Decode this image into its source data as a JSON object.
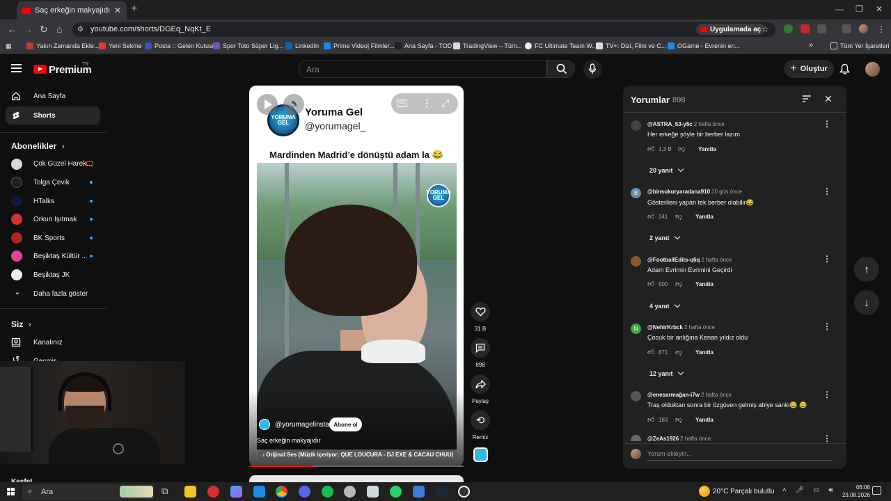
{
  "browser": {
    "tab_title": "Saç erkeğin makyajıdır - YouTube",
    "url": "youtube.com/shorts/DGEq_NqKt_E",
    "open_in_app": "Uygulamada aç",
    "bookmarks": [
      {
        "label": "Yakın Zamanda Ekle...",
        "color": "#c0392b"
      },
      {
        "label": "Yeni Sekme",
        "color": "#e53935"
      },
      {
        "label": "Posta :: Gelen Kutusu",
        "color": "#3f51b5"
      },
      {
        "label": "Spor Toto Süper Lig...",
        "color": "#7b4fc9"
      },
      {
        "label": "LinkedIn",
        "color": "#0a66c2"
      },
      {
        "label": "Prime Video| Filmler...",
        "color": "#1e88e5"
      },
      {
        "label": "Ana Sayfa - TOD",
        "color": "#222222"
      },
      {
        "label": "TradingView – Tüm...",
        "color": "#dddddd"
      },
      {
        "label": "FC Ultimate Team W...",
        "color": "#eeeeee"
      },
      {
        "label": "TV+: Dizi, Film ve C...",
        "color": "#dddddd"
      },
      {
        "label": "OGame - Evrenin en...",
        "color": "#1e88e5"
      }
    ],
    "all_bookmarks": "Tüm Yer İşaretleri"
  },
  "header": {
    "brand": "Premium",
    "region": "TR",
    "search_placeholder": "Ara",
    "create_label": "Oluştur"
  },
  "sidebar": {
    "main": [
      {
        "label": "Ana Sayfa",
        "icon": "home-icon"
      },
      {
        "label": "Shorts",
        "icon": "shorts-icon"
      }
    ],
    "subscriptions_title": "Abonelikler",
    "subscriptions": [
      {
        "label": "Çok Güzel Harek...",
        "color": "#d9d9d9",
        "badge": "live"
      },
      {
        "label": "Tolga Çevik",
        "color": "#1f1f1f",
        "badge": "dot"
      },
      {
        "label": "HTalks",
        "color": "#111a3a",
        "badge": "dot"
      },
      {
        "label": "Orkun Işıtmak",
        "color": "#d63031",
        "badge": "dot"
      },
      {
        "label": "BK Sports",
        "color": "#b3261e",
        "badge": "dot"
      },
      {
        "label": "Beşiktaş Kültür ...",
        "color": "#e84393",
        "badge": "dot"
      },
      {
        "label": "Beşiktaş JK",
        "color": "#eeeeee",
        "badge": "none"
      }
    ],
    "show_more": "Daha fazla göster",
    "you_title": "Siz",
    "you_items": [
      {
        "label": "Kanalınız",
        "icon": "channel-icon"
      },
      {
        "label": "Geçmiş",
        "icon": "history-icon"
      }
    ],
    "explore_title": "Keşfet"
  },
  "short": {
    "brand_name": "Yoruma Gel",
    "brand_handle": "@yorumagel_",
    "logo_text": "YORUMA GEL",
    "caption": "Mardinden Madrid’e dönüştü adam la 😂",
    "channel": "@yorumagelinsta",
    "subscribe": "Abone ol",
    "title": "Saç erkeğin makyajıdır",
    "audio": "♪ Orijinal Ses (Müzik içeriyor: QUE LOUCURA - DJ EXE & CACAU CHUU)",
    "progress": 0.3
  },
  "actions": {
    "likes": "31 B",
    "comments": "898",
    "share": "Paylaş",
    "remix": "Remix"
  },
  "comments": {
    "title": "Yorumlar",
    "count": "898",
    "items": [
      {
        "user": "@ASTRA_53-y5c",
        "time": "2 hafta önce",
        "text": "Her erkeğe şöyle bir berber lazım",
        "likes": "1,3 B",
        "replies": "20 yanıt",
        "avatar_color": "#444444",
        "avatar_letter": ""
      },
      {
        "user": "@binsukuryaradana910",
        "time": "10 gün önce",
        "text": "Gösterileni yapan tek berber olabilir😂",
        "likes": "241",
        "replies": "2 yanıt",
        "avatar_color": "#6a8caf",
        "avatar_letter": "B"
      },
      {
        "user": "@FootballEdits-q6q",
        "time": "2 hafta önce",
        "text": "Adam Evrimin Evrimini Geçirdi",
        "likes": "500",
        "replies": "4 yanıt",
        "avatar_color": "#8b5a2b",
        "avatar_letter": ""
      },
      {
        "user": "@NehirKrbck",
        "time": "2 hafta önce",
        "text": "Çocuk bir anlığına Kenan yıldız oldu",
        "likes": "871",
        "replies": "12 yanıt",
        "avatar_color": "#3ea63e",
        "avatar_letter": "N"
      },
      {
        "user": "@enesarmağan-i7w",
        "time": "2 hafta önce",
        "text": "Traş olduktan sonra bir özgüven gelmiş abiye sanki😂 😂",
        "likes": "183",
        "replies": "",
        "avatar_color": "#555555",
        "avatar_letter": ""
      },
      {
        "user": "@ZeAs1926",
        "time": "2 hafta önce",
        "text": "",
        "likes": "",
        "replies": "",
        "avatar_color": "#666666",
        "avatar_letter": ""
      }
    ],
    "reply_label": "Yanıtla",
    "add_placeholder": "Yorum ekleyin..."
  },
  "taskbar": {
    "search": "Ara",
    "weather": "20°C  Parçalı bulutlu",
    "time": "06:06",
    "date": "23.08.2026"
  }
}
